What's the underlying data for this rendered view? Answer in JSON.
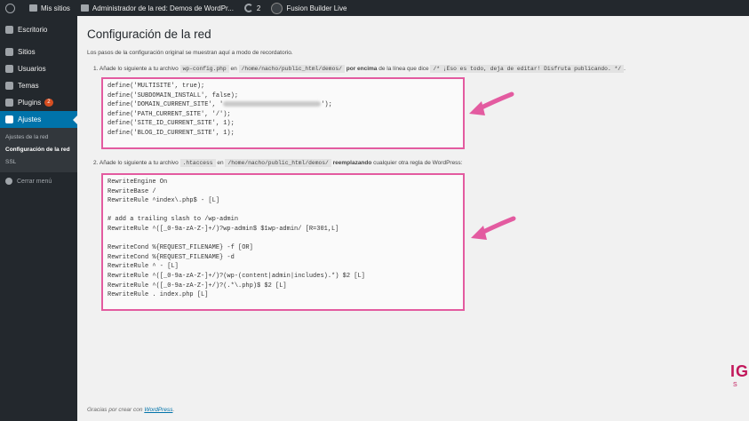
{
  "admin_bar": {
    "my_sites": "Mis sitios",
    "network_admin": "Administrador de la red: Demos de WordPr...",
    "updates_count": "2",
    "fusion": "Fusion Builder Live"
  },
  "sidebar": {
    "items": [
      {
        "label": "Escritorio",
        "icon": "dashboard-icon"
      },
      {
        "label": "Sitios",
        "icon": "sites-icon"
      },
      {
        "label": "Usuarios",
        "icon": "users-icon"
      },
      {
        "label": "Temas",
        "icon": "themes-icon"
      },
      {
        "label": "Plugins",
        "icon": "plugins-icon",
        "badge": "2"
      },
      {
        "label": "Ajustes",
        "icon": "settings-icon",
        "active": true
      }
    ],
    "submenu": [
      "Ajustes de la red",
      "Configuración de la red",
      "SSL"
    ],
    "collapse": "Cerrar menú"
  },
  "page": {
    "title": "Configuración de la red",
    "intro": "Los pasos de la configuración original se muestran aquí a modo de recordatorio.",
    "step1": {
      "prefix": "1. Añade lo siguiente a tu archivo",
      "file": "wp-config.php",
      "in": "en",
      "path": "/home/nacho/public_html/demos/",
      "bold": "por encima",
      "mid": "de la línea que dice",
      "quote": "/* ¡Eso es todo, deja de editar! Disfruta publicando. */",
      "end": "."
    },
    "code1": [
      "define('MULTISITE', true);",
      "define('SUBDOMAIN_INSTALL', false);",
      "define('DOMAIN_CURRENT_SITE', '",
      "define('PATH_CURRENT_SITE', '/');",
      "define('SITE_ID_CURRENT_SITE', 1);",
      "define('BLOG_ID_CURRENT_SITE', 1);"
    ],
    "code1_line3_end": "');",
    "step2": {
      "prefix": "2. Añade lo siguiente a tu archivo",
      "file": ".htaccess",
      "in": "en",
      "path": "/home/nacho/public_html/demos/",
      "bold": "reemplazando",
      "end": "cualquier otra regla de WordPress:"
    },
    "code2": [
      "RewriteEngine On",
      "RewriteBase /",
      "RewriteRule ^index\\.php$ - [L]",
      "",
      "# add a trailing slash to /wp-admin",
      "RewriteRule ^([_0-9a-zA-Z-]+/)?wp-admin$ $1wp-admin/ [R=301,L]",
      "",
      "RewriteCond %{REQUEST_FILENAME} -f [OR]",
      "RewriteCond %{REQUEST_FILENAME} -d",
      "RewriteRule ^ - [L]",
      "RewriteRule ^([_0-9a-zA-Z-]+/)?(wp-(content|admin|includes).*) $2 [L]",
      "RewriteRule ^([_0-9a-zA-Z-]+/)?(.*\\.php)$ $2 [L]",
      "RewriteRule . index.php [L]"
    ]
  },
  "footer": {
    "text": "Gracias por crear con",
    "link": "WordPress",
    "end": "."
  },
  "watermark": {
    "main": "IG",
    "sub": "S"
  },
  "colors": {
    "highlight": "#e35ba0",
    "accent": "#0073aa",
    "adminbar": "#23282d"
  }
}
